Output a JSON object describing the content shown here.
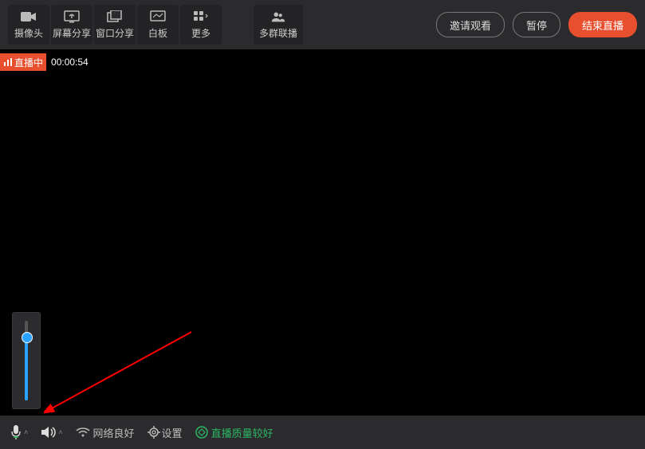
{
  "toolbar": {
    "camera": "摄像头",
    "screenShare": "屏幕分享",
    "windowShare": "窗口分享",
    "whiteboard": "白板",
    "more": "更多",
    "multiGroup": "多群联播"
  },
  "actions": {
    "invite": "邀请观看",
    "pause": "暂停",
    "end": "结束直播"
  },
  "status": {
    "liveLabel": "直播中",
    "timer": "00:00:54"
  },
  "bottom": {
    "network": "网络良好",
    "settings": "设置",
    "quality": "直播质量较好"
  }
}
